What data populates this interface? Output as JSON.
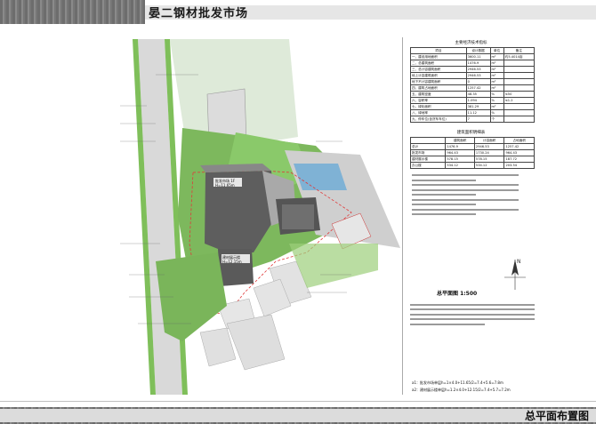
{
  "header": {
    "title": "晏二钢材批发市场"
  },
  "footer": {
    "title": "总平面布置图"
  },
  "plan": {
    "building1_name": "批发市场 1F",
    "building1_height": "H=11.65m",
    "building2_name": "建材展示楼",
    "building2_height": "H=12.15m"
  },
  "table1": {
    "title": "主要经济技术指标",
    "headers": [
      "项目",
      "设计数据",
      "单位",
      "备注"
    ],
    "rows": [
      [
        "一、建设用地面积",
        "3600.11",
        "m²",
        "约5.4014亩"
      ],
      [
        "二、总建筑面积",
        "1476.9",
        "m²",
        ""
      ],
      [
        "三、总计容建筑面积",
        "2946.53",
        "m²",
        ""
      ],
      [
        "地上计容建筑面积",
        "2946.53",
        "m²",
        ""
      ],
      [
        "地下不计容建筑面积",
        "0",
        "m²",
        ""
      ],
      [
        "四、建筑占地面积",
        "1257.42",
        "m²",
        ""
      ],
      [
        "五、建筑密度",
        "48.35",
        "%",
        "≤50"
      ],
      [
        "六、容积率",
        "1.094",
        "%",
        "≤1.2"
      ],
      [
        "七、绿化面积",
        "381.29",
        "m²",
        ""
      ],
      [
        "八、绿地率",
        "11.12",
        "%",
        ""
      ],
      [
        "九、停车位(含货车车位)",
        "7",
        "个",
        ""
      ]
    ]
  },
  "table2": {
    "title": "建筑面积明细表",
    "headers": [
      "",
      "建筑面积",
      "计容面积",
      "占地面积"
    ],
    "rows": [
      [
        "总计",
        "1476.9",
        "2946.53",
        "1257.42"
      ],
      [
        "批发市场",
        "964.43",
        "1730.24",
        "964.43"
      ],
      [
        "建材展示楼",
        "578.15",
        "578.15",
        "187.72"
      ],
      [
        "办公楼",
        "534.12",
        "534.12",
        "203.54"
      ]
    ]
  },
  "scale": {
    "label": "总平面图 1:500"
  },
  "calc": {
    "line1": "a1：批发市场单层h=1×4.0+11.65/2=7.4+5.6=7.8m",
    "line2": "a2：建材展示楼单层h=1.2×4.0+12.15/2=7.4+5.7=7.2m"
  },
  "colors": {
    "grass": "#8cc66a",
    "road": "#d8d8d8",
    "site_border": "#e03a3a",
    "plaza": "#5fa8d8"
  }
}
